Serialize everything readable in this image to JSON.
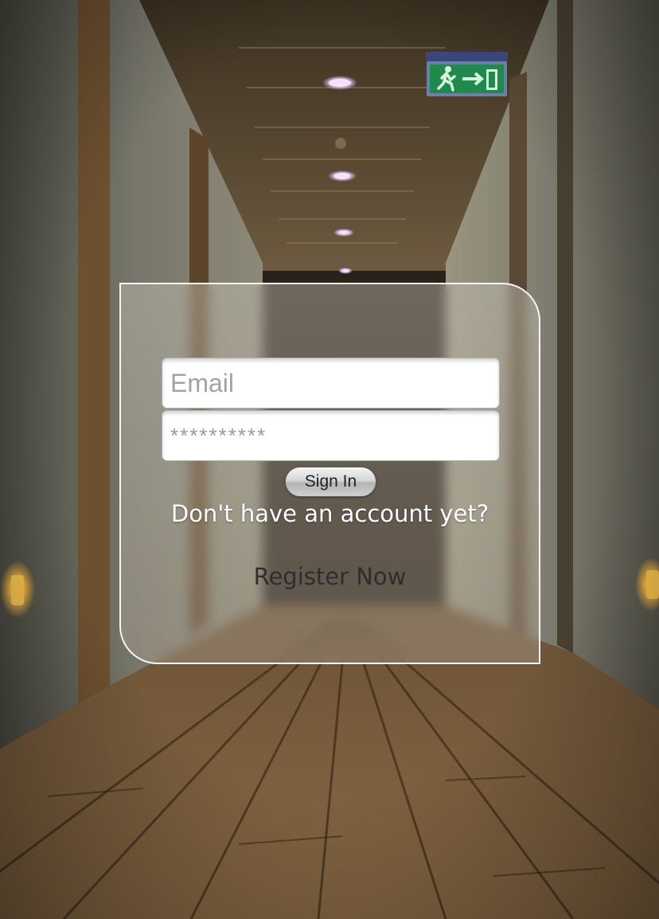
{
  "login": {
    "email_placeholder": "Email",
    "password_placeholder": "**********",
    "signin_label": "Sign In",
    "no_account_text": "Don't have an account yet?",
    "register_label": "Register Now"
  },
  "background": {
    "exit_sign": "emergency-exit-sign-icon"
  },
  "colors": {
    "card_border": "#ffffff",
    "prompt_text": "#ffffff",
    "register_text": "#2e2e2e",
    "exit_sign_green": "#1f8a4c"
  }
}
